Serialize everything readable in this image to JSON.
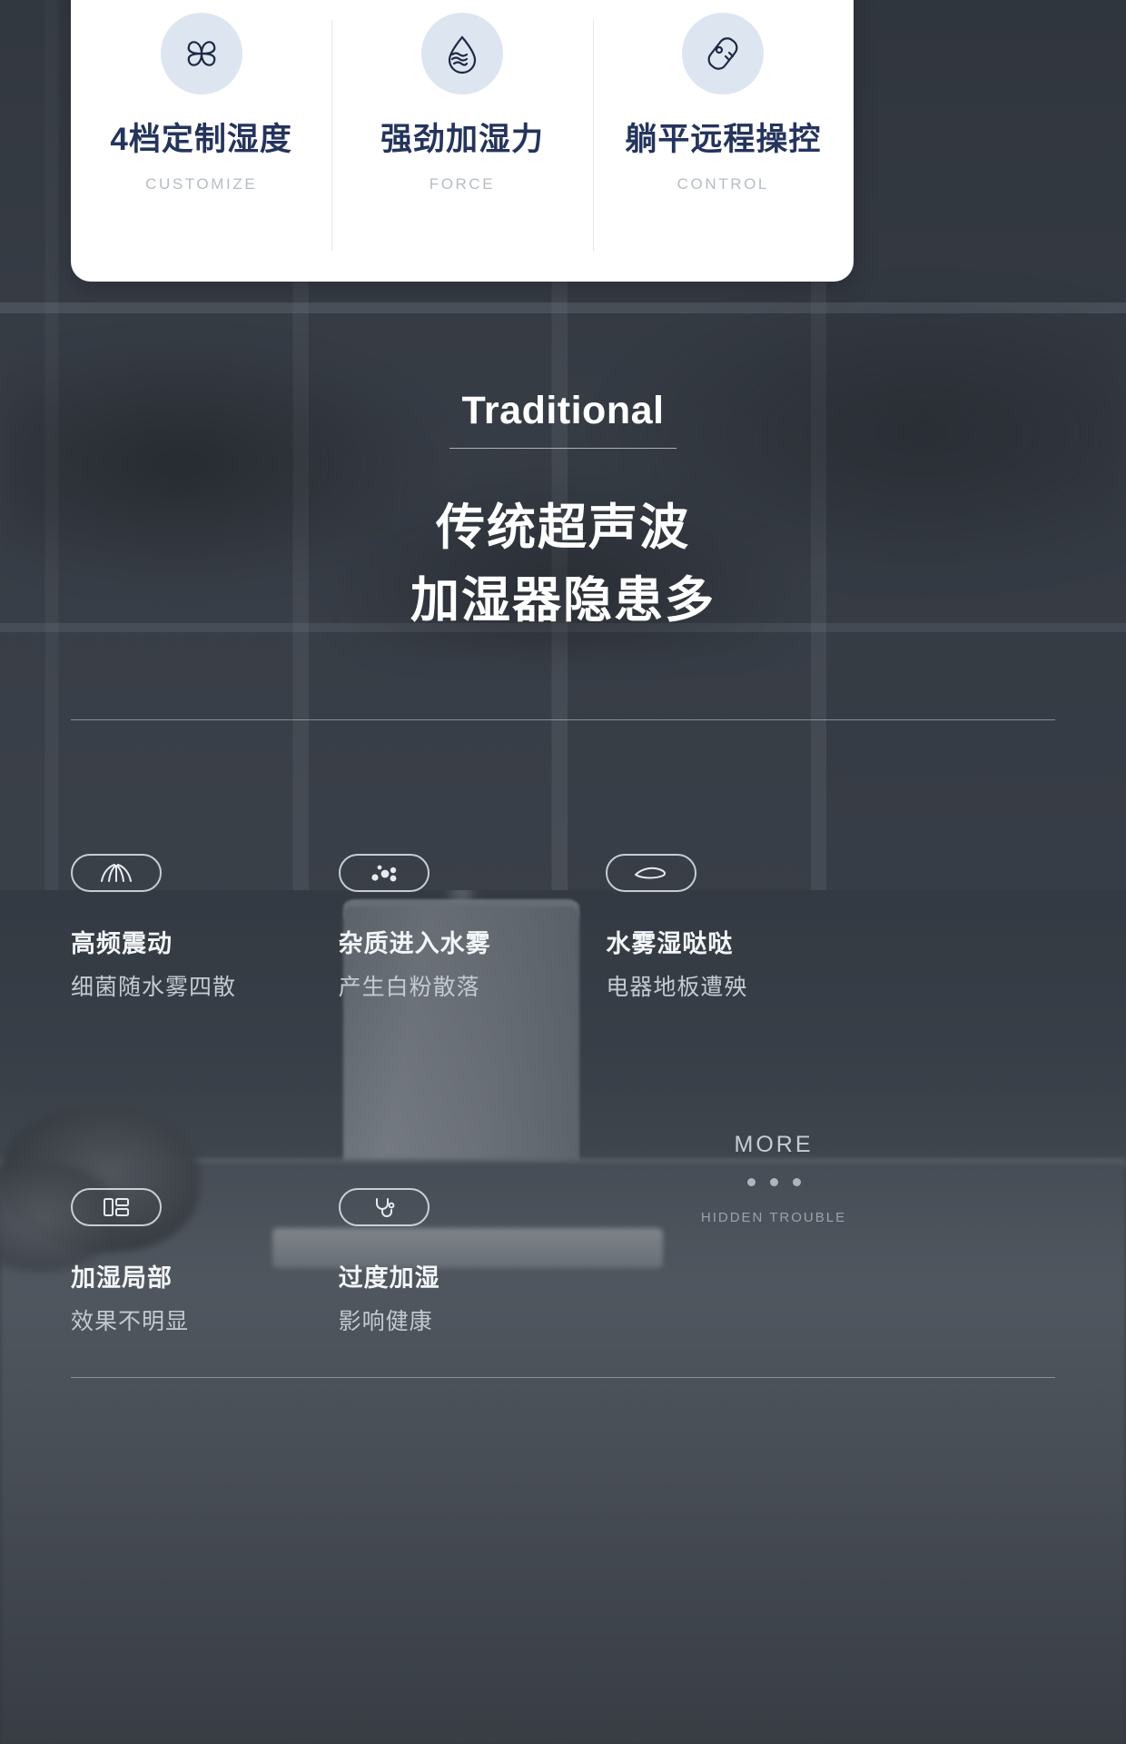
{
  "feature_card": {
    "columns": [
      {
        "icon": "four-petal-fan-icon",
        "title": "4档定制湿度",
        "subtitle": "CUSTOMIZE"
      },
      {
        "icon": "water-drop-wave-icon",
        "title": "强劲加湿力",
        "subtitle": "FORCE"
      },
      {
        "icon": "remote-control-icon",
        "title": "躺平远程操控",
        "subtitle": "CONTROL"
      }
    ]
  },
  "section": {
    "eyebrow_en": "Traditional",
    "heading_line1": "传统超声波",
    "heading_line2": "加湿器隐患多"
  },
  "troubles": [
    {
      "icon": "vibration-waves-icon",
      "title": "高频震动",
      "subtitle": "细菌随水雾四散"
    },
    {
      "icon": "particles-dots-icon",
      "title": "杂质进入水雾",
      "subtitle": "产生白粉散落"
    },
    {
      "icon": "water-puddle-icon",
      "title": "水雾湿哒哒",
      "subtitle": "电器地板遭殃"
    },
    {
      "icon": "room-layout-icon",
      "title": "加湿局部",
      "subtitle": "效果不明显"
    },
    {
      "icon": "stethoscope-icon",
      "title": "过度加湿",
      "subtitle": "影响健康"
    }
  ],
  "more": {
    "label": "MORE",
    "dots": 3,
    "sublabel": "HIDDEN TROUBLE"
  },
  "colors": {
    "card_background": "#ffffff",
    "icon_circle": "#dde5f0",
    "title_navy": "#24345c",
    "subtitle_grey": "#b6bcc4",
    "page_background": "#3a4049",
    "text_white": "#ffffff",
    "text_muted": "#c4cad1"
  }
}
